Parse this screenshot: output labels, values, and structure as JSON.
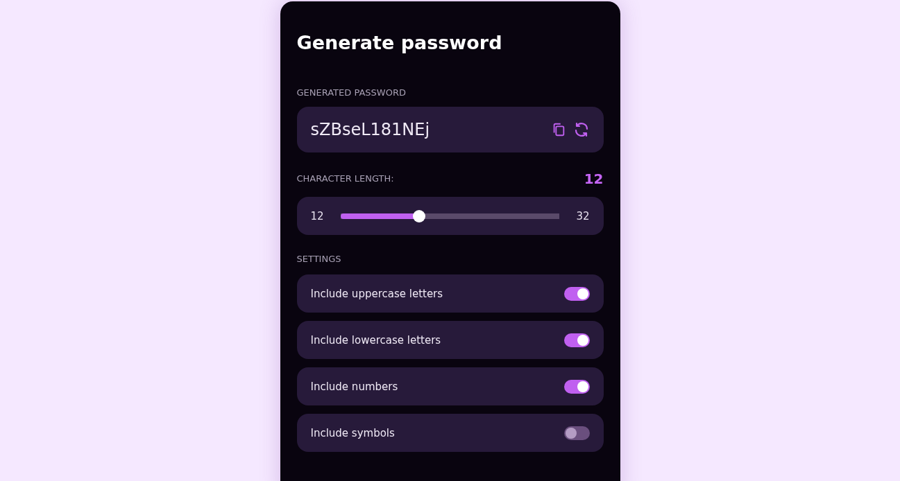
{
  "title": "Generate password",
  "password": {
    "label": "GENERATED PASSWORD",
    "value": "sZBseL181NEj"
  },
  "length": {
    "label": "CHARACTER LENGTH:",
    "value": "12",
    "min": "12",
    "max": "32",
    "level": 0.35
  },
  "settings": {
    "label": "SETTINGS",
    "items": [
      {
        "label": "Include uppercase letters",
        "on": true
      },
      {
        "label": "Include lowercase letters",
        "on": true
      },
      {
        "label": "Include numbers",
        "on": true
      },
      {
        "label": "Include symbols",
        "on": false
      }
    ]
  }
}
